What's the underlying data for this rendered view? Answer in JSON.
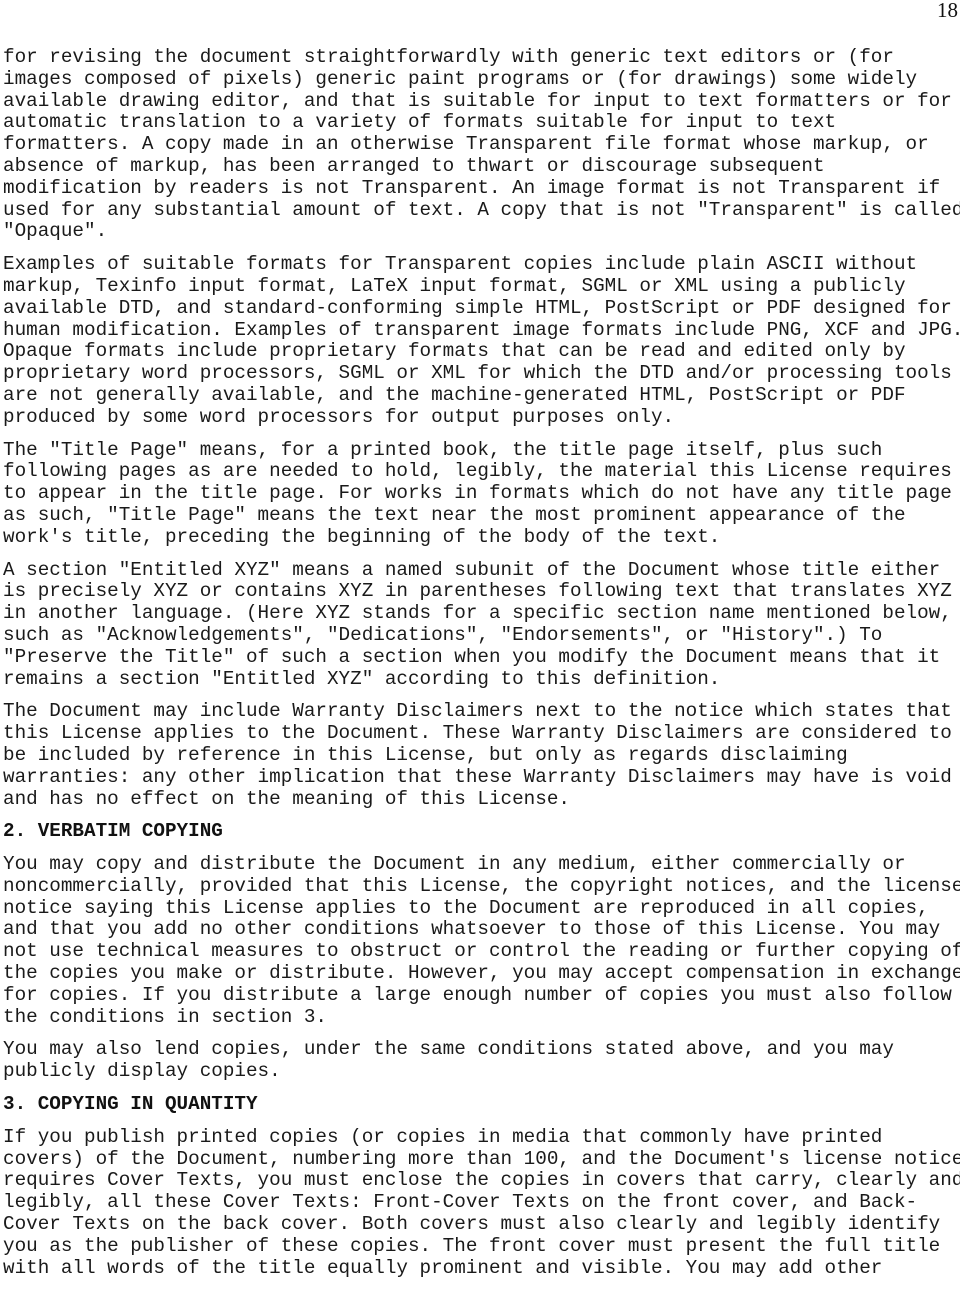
{
  "page": {
    "number": "18"
  },
  "blocks": [
    {
      "type": "paragraph",
      "lines": [
        "for revising the document straightforwardly with generic text editors or (for",
        "images composed of pixels) generic paint programs or (for drawings) some widely",
        "available drawing editor, and that is suitable for input to text formatters or for",
        "automatic translation to a variety of formats suitable for input to text",
        "formatters. A copy made in an otherwise Transparent file format whose markup, or",
        "absence of markup, has been arranged to thwart or discourage subsequent",
        "modification by readers is not Transparent. An image format is not Transparent if",
        "used for any substantial amount of text. A copy that is not \"Transparent\" is called",
        "\"Opaque\"."
      ]
    },
    {
      "type": "paragraph",
      "lines": [
        "Examples of suitable formats for Transparent copies include plain ASCII without",
        "markup, Texinfo input format, LaTeX input format, SGML or XML using a publicly",
        "available DTD, and standard-conforming simple HTML, PostScript or PDF designed for",
        "human modification. Examples of transparent image formats include PNG, XCF and JPG.",
        "Opaque formats include proprietary formats that can be read and edited only by",
        "proprietary word processors, SGML or XML for which the DTD and/or processing tools",
        "are not generally available, and the machine-generated HTML, PostScript or PDF",
        "produced by some word processors for output purposes only."
      ]
    },
    {
      "type": "paragraph",
      "lines": [
        "The \"Title Page\" means, for a printed book, the title page itself, plus such",
        "following pages as are needed to hold, legibly, the material this License requires",
        "to appear in the title page. For works in formats which do not have any title page",
        "as such, \"Title Page\" means the text near the most prominent appearance of the",
        "work's title, preceding the beginning of the body of the text."
      ]
    },
    {
      "type": "paragraph",
      "lines": [
        "A section \"Entitled XYZ\" means a named subunit of the Document whose title either",
        "is precisely XYZ or contains XYZ in parentheses following text that translates XYZ",
        "in another language. (Here XYZ stands for a specific section name mentioned below,",
        "such as \"Acknowledgements\", \"Dedications\", \"Endorsements\", or \"History\".) To",
        "\"Preserve the Title\" of such a section when you modify the Document means that it",
        "remains a section \"Entitled XYZ\" according to this definition."
      ]
    },
    {
      "type": "paragraph",
      "lines": [
        "The Document may include Warranty Disclaimers next to the notice which states that",
        "this License applies to the Document. These Warranty Disclaimers are considered to",
        "be included by reference in this License, but only as regards disclaiming",
        "warranties: any other implication that these Warranty Disclaimers may have is void",
        "and has no effect on the meaning of this License."
      ]
    },
    {
      "type": "heading",
      "text": "2. VERBATIM COPYING"
    },
    {
      "type": "paragraph",
      "lines": [
        "You may copy and distribute the Document in any medium, either commercially or",
        "noncommercially, provided that this License, the copyright notices, and the license",
        "notice saying this License applies to the Document are reproduced in all copies,",
        "and that you add no other conditions whatsoever to those of this License. You may",
        "not use technical measures to obstruct or control the reading or further copying of",
        "the copies you make or distribute. However, you may accept compensation in exchange",
        "for copies. If you distribute a large enough number of copies you must also follow",
        "the conditions in section 3."
      ]
    },
    {
      "type": "paragraph",
      "lines": [
        "You may also lend copies, under the same conditions stated above, and you may",
        "publicly display copies."
      ]
    },
    {
      "type": "heading",
      "text": "3. COPYING IN QUANTITY"
    },
    {
      "type": "paragraph",
      "lines": [
        "If you publish printed copies (or copies in media that commonly have printed",
        "covers) of the Document, numbering more than 100, and the Document's license notice",
        "requires Cover Texts, you must enclose the copies in covers that carry, clearly and",
        "legibly, all these Cover Texts: Front-Cover Texts on the front cover, and Back-",
        "Cover Texts on the back cover. Both covers must also clearly and legibly identify",
        "you as the publisher of these copies. The front cover must present the full title",
        "with all words of the title equally prominent and visible. You may add other"
      ]
    }
  ]
}
